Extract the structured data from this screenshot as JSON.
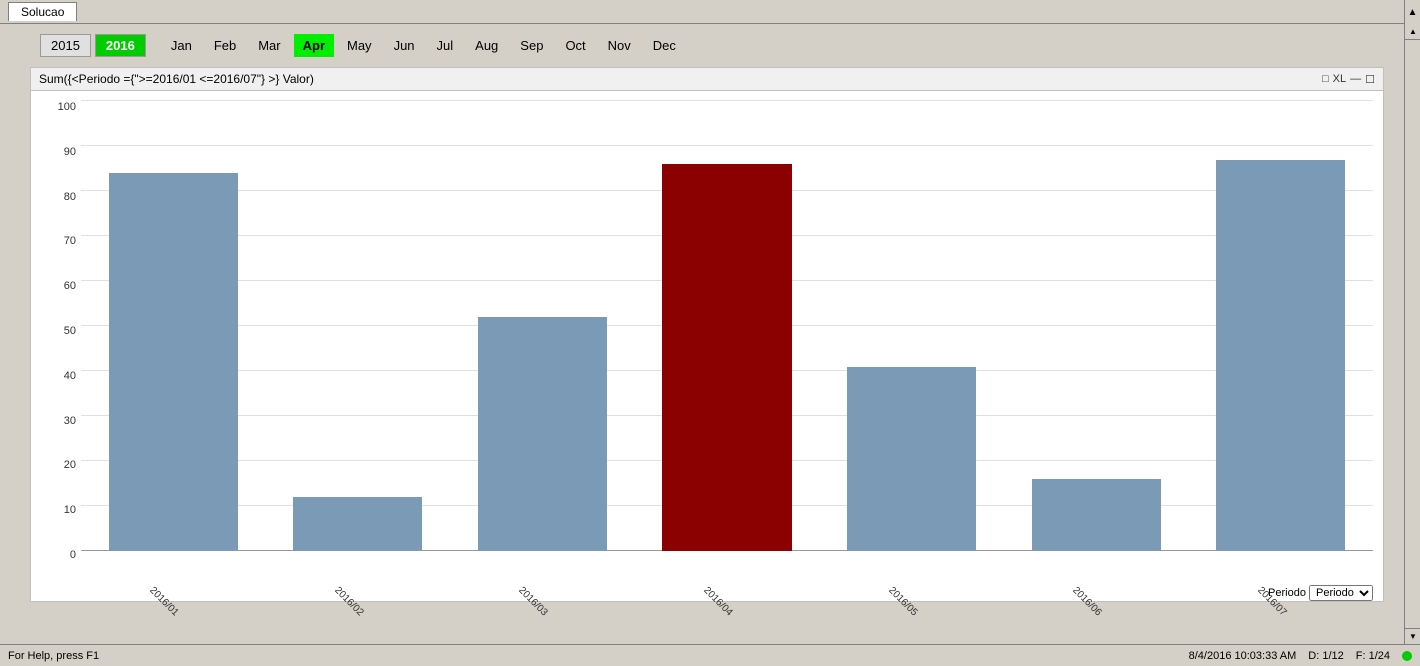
{
  "window": {
    "title": "Solucao"
  },
  "yearMonth": {
    "years": [
      {
        "label": "2015",
        "active": false
      },
      {
        "label": "2016",
        "active": true
      }
    ],
    "months": [
      {
        "label": "Jan",
        "active": false
      },
      {
        "label": "Feb",
        "active": false
      },
      {
        "label": "Mar",
        "active": false
      },
      {
        "label": "Apr",
        "active": true
      },
      {
        "label": "May",
        "active": false
      },
      {
        "label": "Jun",
        "active": false
      },
      {
        "label": "Jul",
        "active": false
      },
      {
        "label": "Aug",
        "active": false
      },
      {
        "label": "Sep",
        "active": false
      },
      {
        "label": "Oct",
        "active": false
      },
      {
        "label": "Nov",
        "active": false
      },
      {
        "label": "Dec",
        "active": false
      }
    ]
  },
  "chart": {
    "title": "Sum({<Periodo ={\">=2016/01 <=2016/07\"} >} Valor)",
    "yLabels": [
      "0",
      "10",
      "20",
      "30",
      "40",
      "50",
      "60",
      "70",
      "80",
      "90",
      "100"
    ],
    "maxValue": 100,
    "bars": [
      {
        "label": "2016/01",
        "value": 84,
        "highlighted": false
      },
      {
        "label": "2016/02",
        "value": 12,
        "highlighted": false
      },
      {
        "label": "2016/03",
        "value": 52,
        "highlighted": false
      },
      {
        "label": "2016/04",
        "value": 86,
        "highlighted": true
      },
      {
        "label": "2016/05",
        "value": 41,
        "highlighted": false
      },
      {
        "label": "2016/06",
        "value": 16,
        "highlighted": false
      },
      {
        "label": "2016/07",
        "value": 87,
        "highlighted": false
      }
    ],
    "xAxisLabel": "Periodo"
  },
  "status": {
    "help_text": "For Help, press F1",
    "datetime": "8/4/2016 10:03:33 AM",
    "position": "D: 1/12",
    "filter": "F: 1/24"
  }
}
